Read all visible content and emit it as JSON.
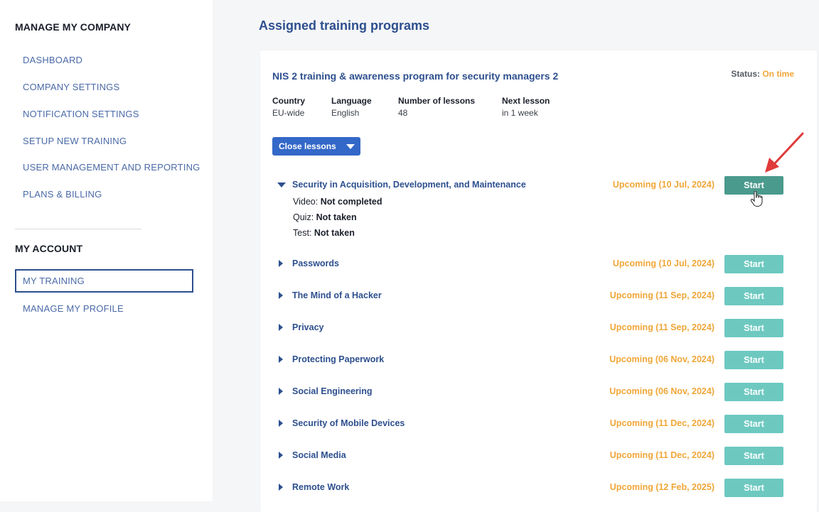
{
  "sidebar": {
    "company_heading": "MANAGE MY COMPANY",
    "company_items": [
      {
        "label": "DASHBOARD"
      },
      {
        "label": "COMPANY SETTINGS"
      },
      {
        "label": "NOTIFICATION SETTINGS"
      },
      {
        "label": "SETUP NEW TRAINING"
      },
      {
        "label": "USER MANAGEMENT AND REPORTING"
      },
      {
        "label": "PLANS & BILLING"
      }
    ],
    "account_heading": "MY ACCOUNT",
    "account_items": [
      {
        "label": "MY TRAINING",
        "active": true
      },
      {
        "label": "MANAGE MY PROFILE"
      }
    ]
  },
  "main": {
    "title": "Assigned training programs",
    "program": {
      "title": "NIS 2 training & awareness program for security managers 2",
      "status_label": "Status:",
      "status_value": "On time",
      "meta": [
        {
          "label": "Country",
          "value": "EU-wide"
        },
        {
          "label": "Language",
          "value": "English"
        },
        {
          "label": "Number of lessons",
          "value": "48"
        },
        {
          "label": "Next lesson",
          "value": "in 1 week"
        }
      ],
      "close_lessons_label": "Close lessons",
      "lessons": [
        {
          "title": "Security in Acquisition, Development, and Maintenance",
          "status": "Upcoming (10 Jul, 2024)",
          "button": "Start",
          "expanded": true,
          "details": [
            {
              "label": "Video:",
              "value": "Not completed"
            },
            {
              "label": "Quiz:",
              "value": "Not taken"
            },
            {
              "label": "Test:",
              "value": "Not taken"
            }
          ]
        },
        {
          "title": "Passwords",
          "status": "Upcoming (10 Jul, 2024)",
          "button": "Start"
        },
        {
          "title": "The Mind of a Hacker",
          "status": "Upcoming (11 Sep, 2024)",
          "button": "Start"
        },
        {
          "title": "Privacy",
          "status": "Upcoming (11 Sep, 2024)",
          "button": "Start"
        },
        {
          "title": "Protecting Paperwork",
          "status": "Upcoming (06 Nov, 2024)",
          "button": "Start"
        },
        {
          "title": "Social Engineering",
          "status": "Upcoming (06 Nov, 2024)",
          "button": "Start"
        },
        {
          "title": "Security of Mobile Devices",
          "status": "Upcoming (11 Dec, 2024)",
          "button": "Start"
        },
        {
          "title": "Social Media",
          "status": "Upcoming (11 Dec, 2024)",
          "button": "Start"
        },
        {
          "title": "Remote Work",
          "status": "Upcoming (12 Feb, 2025)",
          "button": "Start"
        }
      ]
    }
  },
  "colors": {
    "accent_blue": "#2d4f8e",
    "button_blue": "#3468c8",
    "status_orange": "#f0a637",
    "start_teal": "#6dc9c0",
    "start_teal_hover": "#4a9a8d",
    "annotation_red": "#e03a3a"
  },
  "icons": {
    "caret": "chevron-down-icon",
    "collapsed": "triangle-right-icon",
    "expanded": "triangle-down-icon",
    "cursor": "hand-pointer-icon",
    "annotation": "red-arrow-icon"
  }
}
